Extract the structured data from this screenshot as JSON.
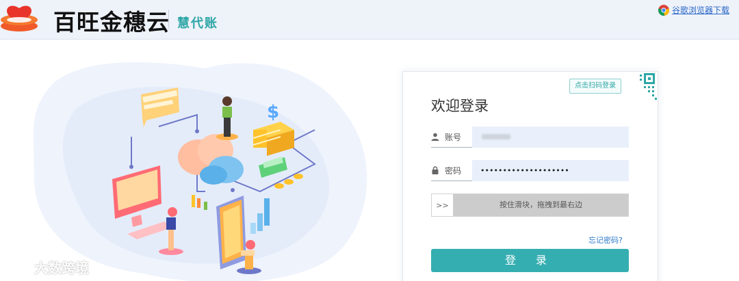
{
  "header": {
    "brand_name": "百旺金穗云",
    "brand_sub": "慧代账",
    "chrome_link": "谷歌浏览器下载"
  },
  "login": {
    "qr_tip": "点击扫码登录",
    "welcome": "欢迎登录",
    "username_label": "账号",
    "password_label": "密码",
    "password_value": "••••••••••••••••••••",
    "slider_handle": ">>",
    "slider_text": "按住滑块，拖拽到最右边",
    "forgot": "忘记密码?",
    "submit": "登 录"
  },
  "watermark": {
    "text": "大数跨境"
  },
  "colors": {
    "accent": "#35aeb1",
    "header_bg": "#eef2f9",
    "brand_sub": "#2ea6a6",
    "link": "#2b68c8"
  },
  "icons": [
    "logo-mark",
    "chrome-icon",
    "user-icon",
    "lock-icon",
    "qr-code-icon",
    "watermark-logo"
  ]
}
